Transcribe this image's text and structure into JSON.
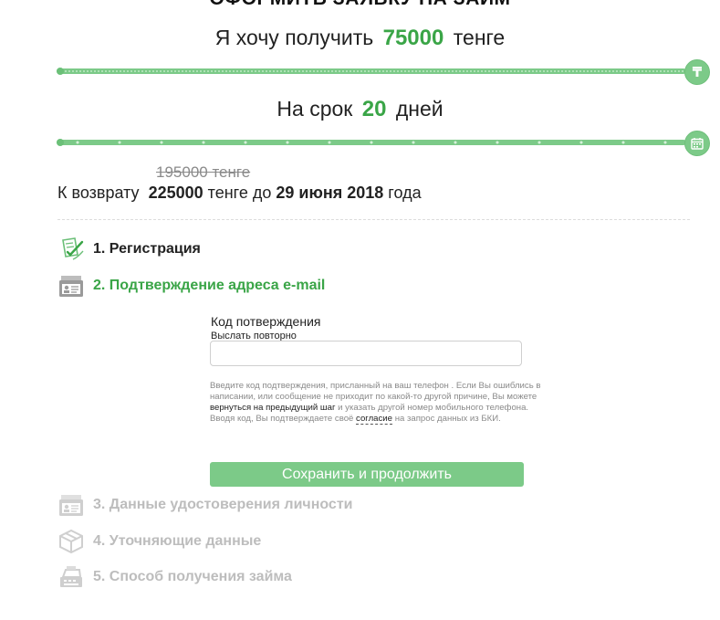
{
  "title": "ОФОРМИТЬ ЗАЯВКУ НА ЗАЙМ",
  "calculator": {
    "amount_prefix": "Я хочу получить",
    "amount_value": "75000",
    "amount_suffix": "тенге",
    "amount_handle_symbol": "₸",
    "term_prefix": "На срок",
    "term_value": "20",
    "term_suffix": "дней",
    "old_amount": "195000 тенге",
    "repay_prefix": "К возврату",
    "repay_amount": "225000",
    "repay_middle": "тенге до",
    "repay_date": "29 июня 2018",
    "repay_suffix": "года",
    "amount_slider_level": 1.0,
    "term_slider_level": 1.0
  },
  "steps": [
    {
      "label": "1. Регистрация",
      "state": "done",
      "icon": "document-check-icon"
    },
    {
      "label": "2. Подтверждение адреса e-mail",
      "state": "active",
      "icon": "id-card-icon"
    },
    {
      "label": "3. Данные удостоверения личности",
      "state": "pending",
      "icon": "id-card-icon"
    },
    {
      "label": "4. Уточняющие данные",
      "state": "pending",
      "icon": "box-icon"
    },
    {
      "label": "5. Способ получения займа",
      "state": "pending",
      "icon": "cash-register-icon"
    }
  ],
  "form": {
    "code_label": "Код потверждения",
    "resend_link": "Выслать повторно",
    "code_value": "",
    "hint_1": "Введите код подтверждения, присланный на ваш телефон . Если Вы ошиблись в написании, или сообщение не приходит по какой-то другой причине, Вы можете",
    "hint_link_back": "вернуться на предыдущий шаг",
    "hint_2": "и указать другой номер мобильного телефона. Вводя код, Вы подтверждаете своё",
    "hint_link_consent": "согласие",
    "hint_3": "на запрос данных из БКИ.",
    "submit_label": "Сохранить и продолжить"
  },
  "colors": {
    "accent": "#3aa547",
    "slider": "#7cca88",
    "inactive": "#bdbdbd"
  }
}
